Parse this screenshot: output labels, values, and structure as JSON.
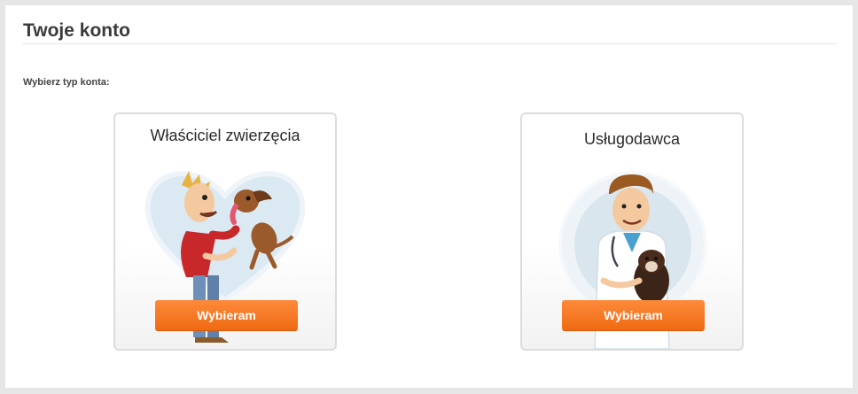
{
  "page": {
    "title": "Twoje konto",
    "prompt": "Wybierz typ konta:"
  },
  "cards": [
    {
      "title": "Właściciel zwierzęcia",
      "button_label": "Wybieram",
      "illustration": "owner-with-dog-icon"
    },
    {
      "title": "Usługodawca",
      "button_label": "Wybieram",
      "illustration": "veterinarian-icon"
    }
  ],
  "colors": {
    "accent": "#f37620",
    "heading": "#3a3a3a",
    "panel": "#ffffff",
    "background": "#e6e6e6"
  }
}
